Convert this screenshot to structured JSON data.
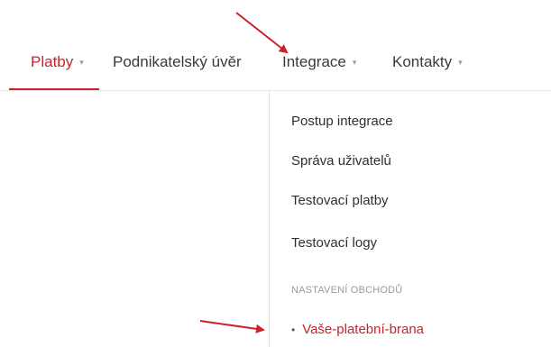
{
  "nav": {
    "items": [
      {
        "label": "Platby",
        "caret": "▾",
        "active": true
      },
      {
        "label": "Podnikatelský úvěr"
      },
      {
        "label": "Integrace",
        "caret": "▾"
      },
      {
        "label": "Kontakty",
        "caret": "▾"
      }
    ]
  },
  "dropdown": {
    "items": [
      {
        "label": "Postup integrace"
      },
      {
        "label": "Správa uživatelů"
      },
      {
        "label": "Testovací platby"
      },
      {
        "label": "Testovací logy"
      }
    ],
    "section_header": "NASTAVENÍ OBCHODŮ",
    "highlight_link": {
      "bullet": "•",
      "label": "Vaše-platební-brana"
    }
  },
  "colors": {
    "accent": "#c8232b",
    "text": "#3a3a3a",
    "muted": "#9b9b9b"
  }
}
